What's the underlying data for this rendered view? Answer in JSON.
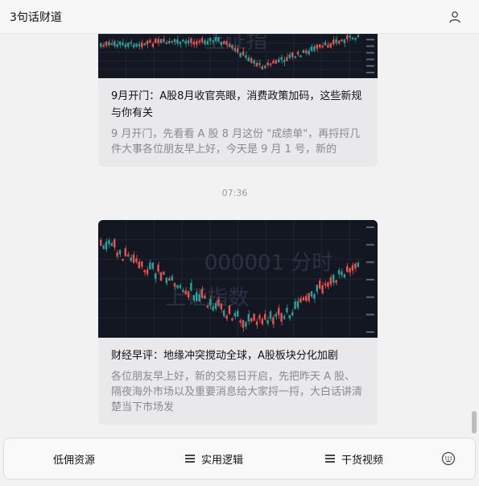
{
  "header": {
    "title": "3句话财道",
    "user_icon": "user-icon"
  },
  "messages": [
    {
      "title": "9月开门：A股8月收官亮眼，消费政策加码，这些新规与你有关",
      "desc": "9 月开门，先看看 A 股 8 月这份 \"成绩单\"，再捋捋几件大事各位朋友早上好，今天是 9 月 1 号，新的",
      "thumb_watermark": "上证指"
    },
    {
      "title": "财经早评：地缘冲突搅动全球，A股板块分化加剧",
      "desc": "各位朋友早上好，新的交易日开启，先把昨天 A 股、隔夜海外市场以及重要消息给大家捋一捋，大白话讲清楚当下市场发",
      "thumb_watermark_1": "000001 分时",
      "thumb_watermark_2": "上证指数"
    }
  ],
  "timestamp": "07:36",
  "menu": {
    "items": [
      {
        "label": "低佣资源",
        "has_menu_icon": false
      },
      {
        "label": "实用逻辑",
        "has_menu_icon": true
      },
      {
        "label": "干货视频",
        "has_menu_icon": true
      }
    ],
    "keyboard_icon": "keyboard-icon"
  },
  "colors": {
    "chart_bg": "#131722",
    "up": "#ef5350",
    "down": "#26a69a",
    "card_bg": "#e9e9eb",
    "page_bg": "#f2f2f2"
  }
}
